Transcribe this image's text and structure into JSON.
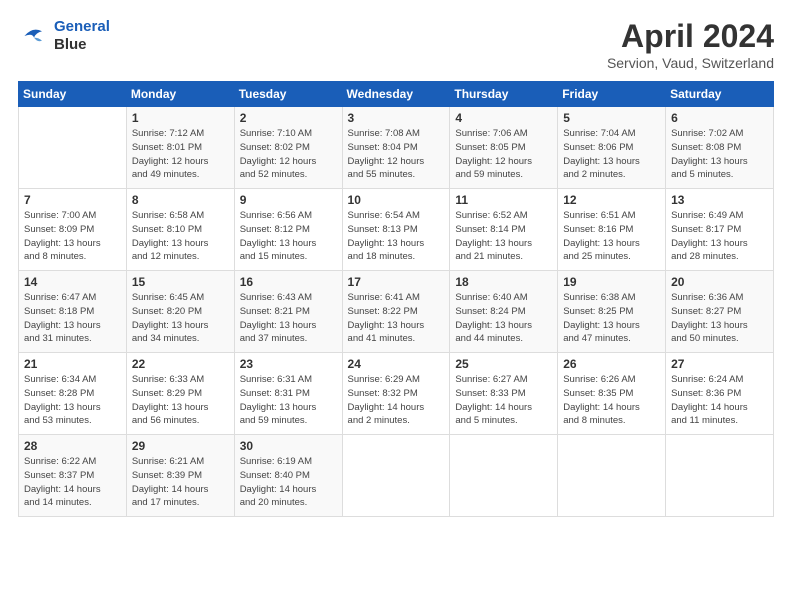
{
  "logo": {
    "line1": "General",
    "line2": "Blue"
  },
  "title": "April 2024",
  "subtitle": "Servion, Vaud, Switzerland",
  "days_of_week": [
    "Sunday",
    "Monday",
    "Tuesday",
    "Wednesday",
    "Thursday",
    "Friday",
    "Saturday"
  ],
  "weeks": [
    [
      {
        "num": "",
        "info": ""
      },
      {
        "num": "1",
        "info": "Sunrise: 7:12 AM\nSunset: 8:01 PM\nDaylight: 12 hours\nand 49 minutes."
      },
      {
        "num": "2",
        "info": "Sunrise: 7:10 AM\nSunset: 8:02 PM\nDaylight: 12 hours\nand 52 minutes."
      },
      {
        "num": "3",
        "info": "Sunrise: 7:08 AM\nSunset: 8:04 PM\nDaylight: 12 hours\nand 55 minutes."
      },
      {
        "num": "4",
        "info": "Sunrise: 7:06 AM\nSunset: 8:05 PM\nDaylight: 12 hours\nand 59 minutes."
      },
      {
        "num": "5",
        "info": "Sunrise: 7:04 AM\nSunset: 8:06 PM\nDaylight: 13 hours\nand 2 minutes."
      },
      {
        "num": "6",
        "info": "Sunrise: 7:02 AM\nSunset: 8:08 PM\nDaylight: 13 hours\nand 5 minutes."
      }
    ],
    [
      {
        "num": "7",
        "info": "Sunrise: 7:00 AM\nSunset: 8:09 PM\nDaylight: 13 hours\nand 8 minutes."
      },
      {
        "num": "8",
        "info": "Sunrise: 6:58 AM\nSunset: 8:10 PM\nDaylight: 13 hours\nand 12 minutes."
      },
      {
        "num": "9",
        "info": "Sunrise: 6:56 AM\nSunset: 8:12 PM\nDaylight: 13 hours\nand 15 minutes."
      },
      {
        "num": "10",
        "info": "Sunrise: 6:54 AM\nSunset: 8:13 PM\nDaylight: 13 hours\nand 18 minutes."
      },
      {
        "num": "11",
        "info": "Sunrise: 6:52 AM\nSunset: 8:14 PM\nDaylight: 13 hours\nand 21 minutes."
      },
      {
        "num": "12",
        "info": "Sunrise: 6:51 AM\nSunset: 8:16 PM\nDaylight: 13 hours\nand 25 minutes."
      },
      {
        "num": "13",
        "info": "Sunrise: 6:49 AM\nSunset: 8:17 PM\nDaylight: 13 hours\nand 28 minutes."
      }
    ],
    [
      {
        "num": "14",
        "info": "Sunrise: 6:47 AM\nSunset: 8:18 PM\nDaylight: 13 hours\nand 31 minutes."
      },
      {
        "num": "15",
        "info": "Sunrise: 6:45 AM\nSunset: 8:20 PM\nDaylight: 13 hours\nand 34 minutes."
      },
      {
        "num": "16",
        "info": "Sunrise: 6:43 AM\nSunset: 8:21 PM\nDaylight: 13 hours\nand 37 minutes."
      },
      {
        "num": "17",
        "info": "Sunrise: 6:41 AM\nSunset: 8:22 PM\nDaylight: 13 hours\nand 41 minutes."
      },
      {
        "num": "18",
        "info": "Sunrise: 6:40 AM\nSunset: 8:24 PM\nDaylight: 13 hours\nand 44 minutes."
      },
      {
        "num": "19",
        "info": "Sunrise: 6:38 AM\nSunset: 8:25 PM\nDaylight: 13 hours\nand 47 minutes."
      },
      {
        "num": "20",
        "info": "Sunrise: 6:36 AM\nSunset: 8:27 PM\nDaylight: 13 hours\nand 50 minutes."
      }
    ],
    [
      {
        "num": "21",
        "info": "Sunrise: 6:34 AM\nSunset: 8:28 PM\nDaylight: 13 hours\nand 53 minutes."
      },
      {
        "num": "22",
        "info": "Sunrise: 6:33 AM\nSunset: 8:29 PM\nDaylight: 13 hours\nand 56 minutes."
      },
      {
        "num": "23",
        "info": "Sunrise: 6:31 AM\nSunset: 8:31 PM\nDaylight: 13 hours\nand 59 minutes."
      },
      {
        "num": "24",
        "info": "Sunrise: 6:29 AM\nSunset: 8:32 PM\nDaylight: 14 hours\nand 2 minutes."
      },
      {
        "num": "25",
        "info": "Sunrise: 6:27 AM\nSunset: 8:33 PM\nDaylight: 14 hours\nand 5 minutes."
      },
      {
        "num": "26",
        "info": "Sunrise: 6:26 AM\nSunset: 8:35 PM\nDaylight: 14 hours\nand 8 minutes."
      },
      {
        "num": "27",
        "info": "Sunrise: 6:24 AM\nSunset: 8:36 PM\nDaylight: 14 hours\nand 11 minutes."
      }
    ],
    [
      {
        "num": "28",
        "info": "Sunrise: 6:22 AM\nSunset: 8:37 PM\nDaylight: 14 hours\nand 14 minutes."
      },
      {
        "num": "29",
        "info": "Sunrise: 6:21 AM\nSunset: 8:39 PM\nDaylight: 14 hours\nand 17 minutes."
      },
      {
        "num": "30",
        "info": "Sunrise: 6:19 AM\nSunset: 8:40 PM\nDaylight: 14 hours\nand 20 minutes."
      },
      {
        "num": "",
        "info": ""
      },
      {
        "num": "",
        "info": ""
      },
      {
        "num": "",
        "info": ""
      },
      {
        "num": "",
        "info": ""
      }
    ]
  ]
}
